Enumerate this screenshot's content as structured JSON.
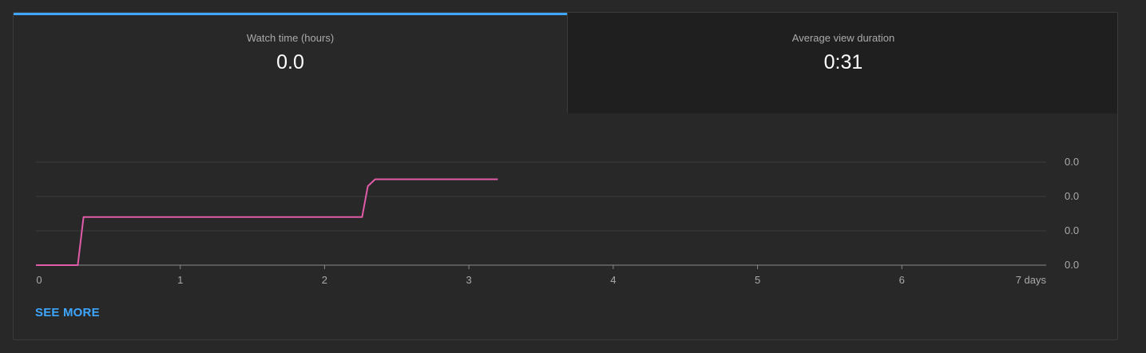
{
  "tabs": [
    {
      "label": "Watch time (hours)",
      "value": "0.0",
      "active": true
    },
    {
      "label": "Average view duration",
      "value": "0:31",
      "active": false
    }
  ],
  "see_more_label": "SEE MORE",
  "colors": {
    "accent": "#3ea6ff",
    "series_line": "#e05ba8",
    "grid": "#3d3d3d",
    "axis": "#8a8a8a"
  },
  "chart_data": {
    "type": "line",
    "x_tick_labels": [
      "0",
      "1",
      "2",
      "3",
      "4",
      "5",
      "6",
      "7 days"
    ],
    "y_tick_labels": [
      "0.0",
      "0.0",
      "0.0",
      "0.0"
    ],
    "xlim": [
      0,
      7
    ],
    "ylim": [
      0,
      3
    ],
    "grid": true,
    "series": [
      {
        "x": [
          0,
          0.29,
          0.33,
          2.26,
          2.3,
          2.35,
          3.2
        ],
        "y": [
          0,
          0,
          1.4,
          1.4,
          2.3,
          2.5,
          2.5
        ]
      }
    ]
  }
}
